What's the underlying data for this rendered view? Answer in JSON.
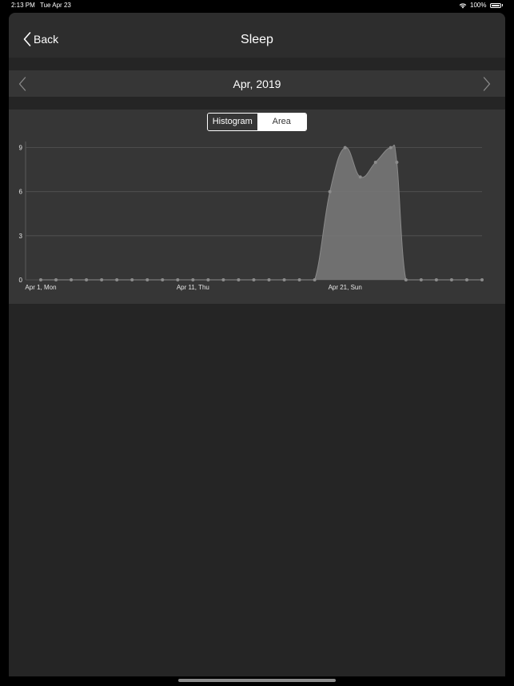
{
  "status_bar": {
    "time": "2:13 PM",
    "date": "Tue Apr 23",
    "battery": "100%"
  },
  "nav": {
    "back_label": "Back",
    "title": "Sleep"
  },
  "month_nav": {
    "label": "Apr, 2019"
  },
  "segmented": {
    "histogram_label": "Histogram",
    "area_label": "Area",
    "selected": "Area"
  },
  "colors": {
    "background": "#252525",
    "panel": "#363636",
    "fill": "#7a7a7a",
    "point": "#8c8c8c"
  },
  "chart_data": {
    "type": "area",
    "x": [
      1,
      2,
      3,
      4,
      5,
      6,
      7,
      8,
      9,
      10,
      11,
      12,
      13,
      14,
      15,
      16,
      17,
      18,
      19,
      20,
      21,
      22,
      23,
      24,
      25,
      26,
      27,
      28,
      29,
      30
    ],
    "values": [
      0,
      0,
      0,
      0,
      0,
      0,
      0,
      0,
      0,
      0,
      0,
      0,
      0,
      0,
      0,
      0,
      0,
      0,
      0,
      6,
      9,
      7,
      8,
      9,
      8,
      0,
      0,
      0,
      0,
      0,
      0
    ],
    "series_points": [
      {
        "x": 1,
        "y": 0
      },
      {
        "x": 2,
        "y": 0
      },
      {
        "x": 3,
        "y": 0
      },
      {
        "x": 4,
        "y": 0
      },
      {
        "x": 5,
        "y": 0
      },
      {
        "x": 6,
        "y": 0
      },
      {
        "x": 7,
        "y": 0
      },
      {
        "x": 8,
        "y": 0
      },
      {
        "x": 9,
        "y": 0
      },
      {
        "x": 10,
        "y": 0
      },
      {
        "x": 11,
        "y": 0
      },
      {
        "x": 12,
        "y": 0
      },
      {
        "x": 13,
        "y": 0
      },
      {
        "x": 14,
        "y": 0
      },
      {
        "x": 15,
        "y": 0
      },
      {
        "x": 16,
        "y": 0
      },
      {
        "x": 17,
        "y": 0
      },
      {
        "x": 18,
        "y": 0
      },
      {
        "x": 19,
        "y": 0
      },
      {
        "x": 20,
        "y": 6
      },
      {
        "x": 21,
        "y": 9
      },
      {
        "x": 22,
        "y": 7
      },
      {
        "x": 23,
        "y": 8
      },
      {
        "x": 24,
        "y": 9
      },
      {
        "x": 24.4,
        "y": 8
      },
      {
        "x": 25,
        "y": 0
      },
      {
        "x": 26,
        "y": 0
      },
      {
        "x": 27,
        "y": 0
      },
      {
        "x": 28,
        "y": 0
      },
      {
        "x": 29,
        "y": 0
      },
      {
        "x": 30,
        "y": 0
      }
    ],
    "y_ticks": [
      0,
      3,
      6,
      9
    ],
    "x_tick_labels": [
      {
        "x": 1,
        "label": "Apr 1, Mon"
      },
      {
        "x": 11,
        "label": "Apr 11, Thu"
      },
      {
        "x": 21,
        "label": "Apr 21, Sun"
      }
    ],
    "xlim": [
      1,
      30
    ],
    "ylim": [
      0,
      10.5
    ],
    "grid": true,
    "legend": "none"
  }
}
